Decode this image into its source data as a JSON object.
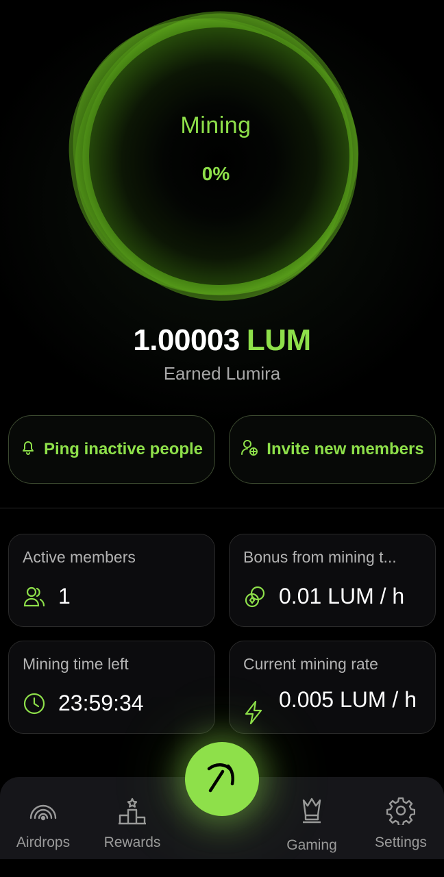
{
  "orb": {
    "title": "Mining",
    "percent": "0%"
  },
  "balance": {
    "amount": "1.00003",
    "unit": "LUM",
    "caption": "Earned Lumira"
  },
  "actions": {
    "ping_label": "Ping inactive people",
    "invite_label": "Invite new members"
  },
  "stats": {
    "active_members": {
      "label": "Active members",
      "value": "1",
      "icon": "users-icon"
    },
    "bonus": {
      "label": "Bonus from mining t...",
      "value": "0.01 LUM / h",
      "icon": "coins-icon"
    },
    "time_left": {
      "label": "Mining time left",
      "value": "23:59:34",
      "icon": "clock-icon"
    },
    "rate": {
      "label": "Current mining rate",
      "value": "0.005 LUM / h",
      "icon": "lightning-icon"
    }
  },
  "nav": {
    "items": [
      {
        "label": "Airdrops",
        "icon": "signal-icon"
      },
      {
        "label": "Rewards",
        "icon": "podium-icon"
      },
      {
        "label": "Gaming",
        "icon": "crown-icon"
      },
      {
        "label": "Settings",
        "icon": "gear-icon"
      }
    ],
    "center_icon": "pickaxe-icon"
  },
  "colors": {
    "accent": "#8ee04a",
    "background": "#000000",
    "card": "#0c0c0e"
  }
}
